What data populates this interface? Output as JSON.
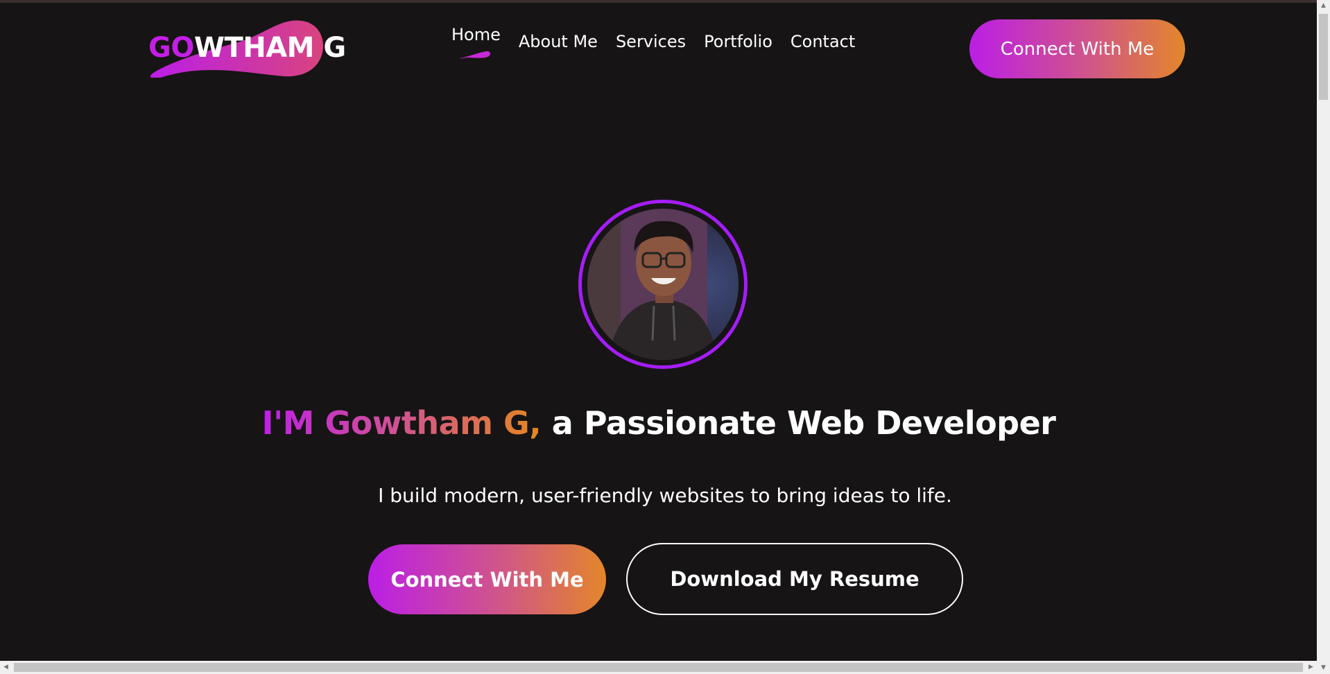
{
  "header": {
    "logo": {
      "text_gradient_part": "GO",
      "text_rest": "WTHAM G"
    },
    "nav": [
      {
        "label": "Home",
        "active": true
      },
      {
        "label": "About Me"
      },
      {
        "label": "Services"
      },
      {
        "label": "Portfolio"
      },
      {
        "label": "Contact"
      }
    ],
    "cta_label": "Connect With Me"
  },
  "hero": {
    "headline_highlight": "I'M Gowtham G,",
    "headline_rest": " a Passionate Web Developer",
    "subtitle": "I build modern, user-friendly websites to bring ideas to life.",
    "primary_cta_label": "Connect With Me",
    "secondary_cta_label": "Download My Resume"
  },
  "colors": {
    "background": "#161414",
    "gradient_start": "#bb1ee6",
    "gradient_mid": "#d0558a",
    "gradient_end": "#e3862a",
    "avatar_ring": "#a51dfa",
    "text": "#ffffff"
  },
  "icons": {
    "logo_swoosh": "logo-swoosh-icon",
    "nav_active_indicator": "active-underline-icon",
    "profile_photo": "profile-photo"
  }
}
